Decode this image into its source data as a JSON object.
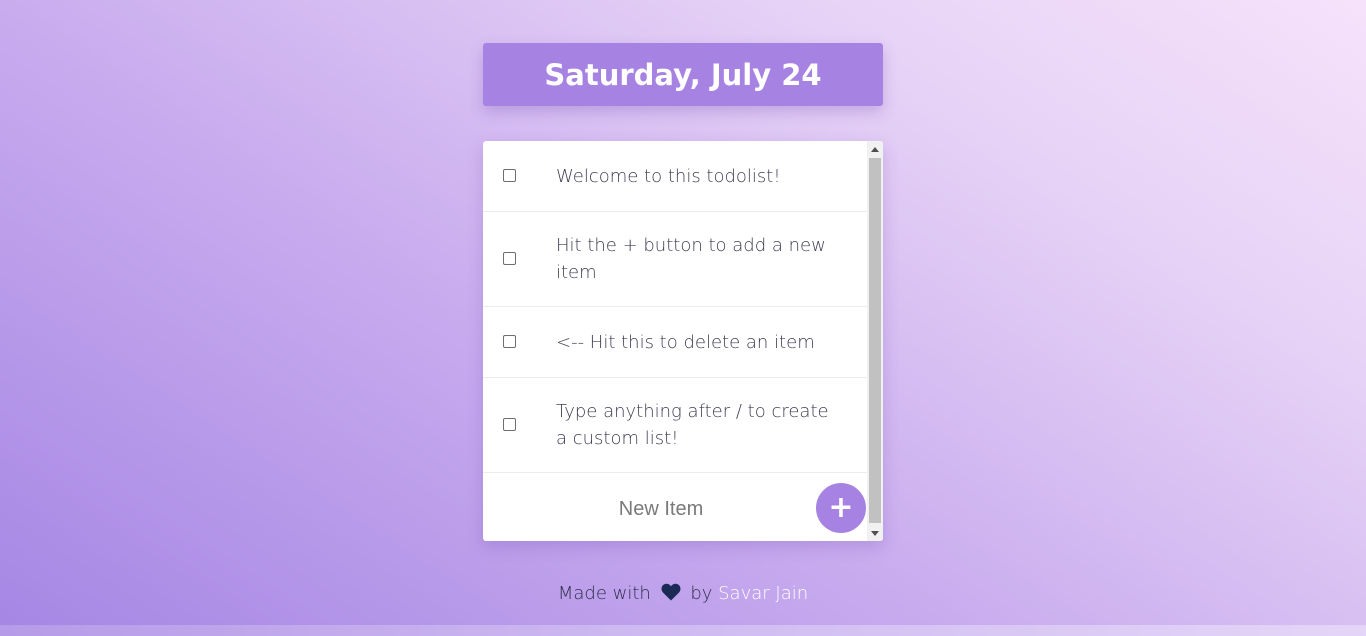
{
  "header": {
    "date": "Saturday, July 24"
  },
  "list": {
    "items": [
      {
        "text": "Welcome to this todolist!",
        "checked": false
      },
      {
        "text": "Hit the + button to add a new item",
        "checked": false
      },
      {
        "text": "<-- Hit this to delete an item",
        "checked": false
      },
      {
        "text": "Type anything after / to create a custom list!",
        "checked": false
      }
    ],
    "new_item_placeholder": "New Item",
    "add_button_label": "+"
  },
  "footer": {
    "made_with": "Made with",
    "by": "by",
    "author": "Savar Jain",
    "heart_icon": "heart-icon"
  },
  "colors": {
    "accent": "#a683e3",
    "heart": "#1b2a55",
    "text": "#3e3e52"
  }
}
